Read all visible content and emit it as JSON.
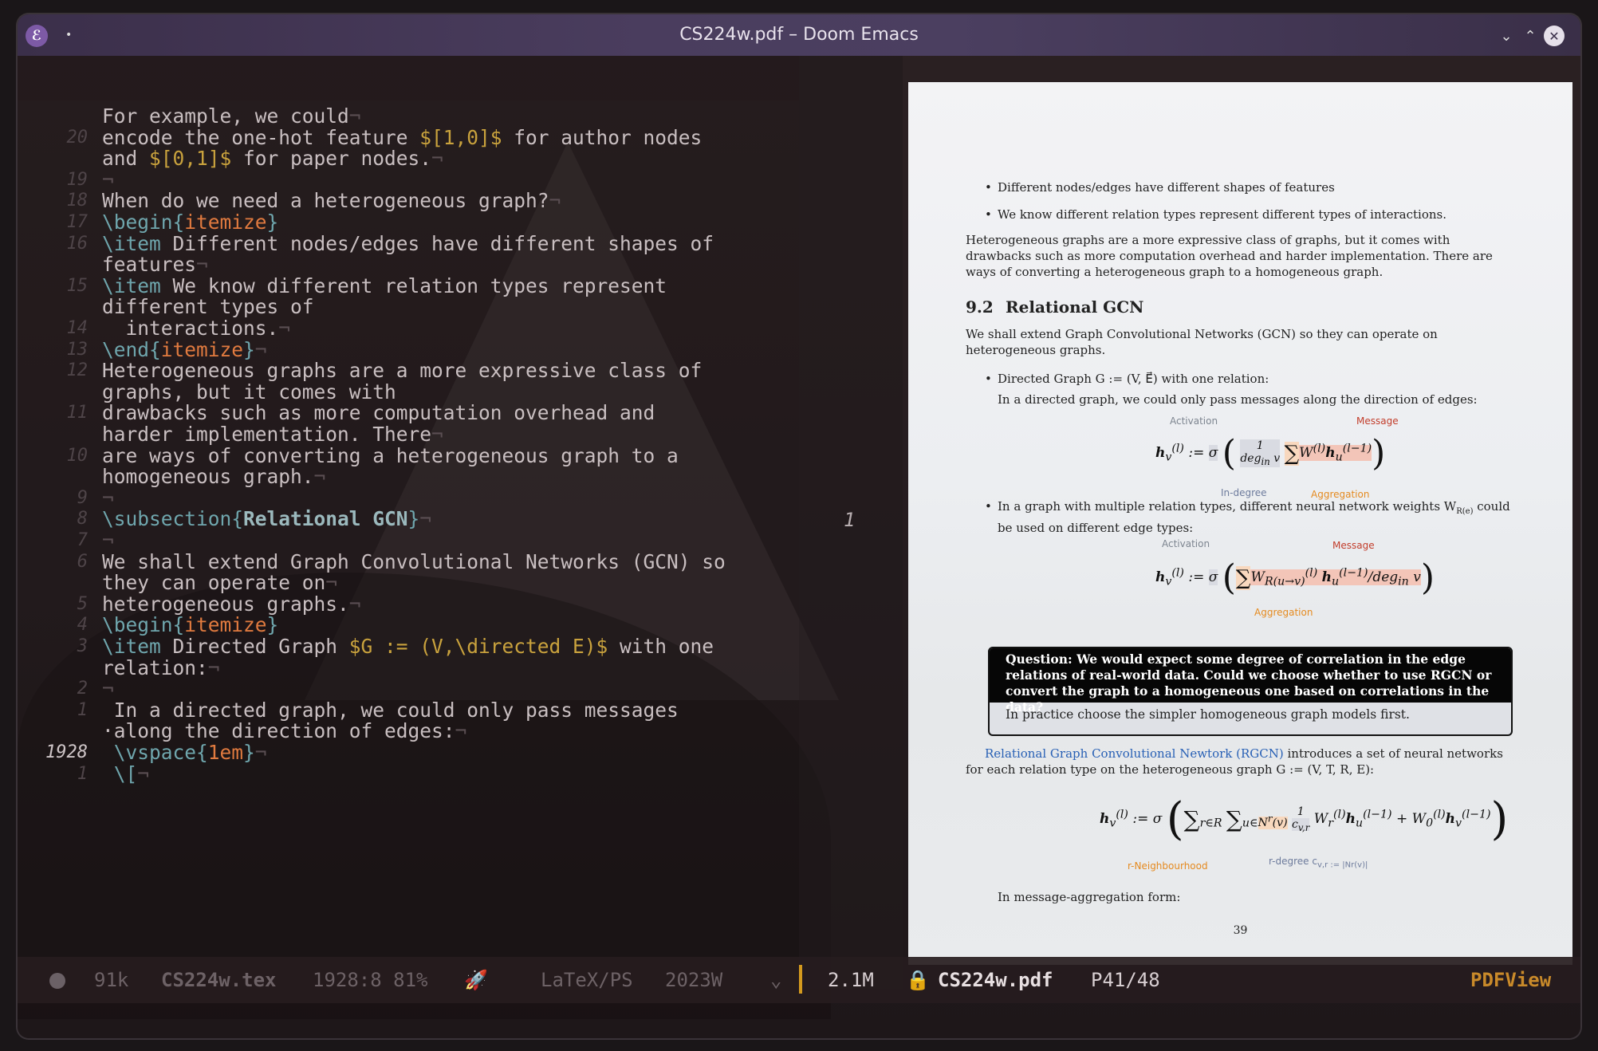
{
  "window": {
    "title": "CS224w.pdf – Doom Emacs",
    "app_icon": "emacs-icon"
  },
  "editor": {
    "lines": [
      {
        "ln": "",
        "segments": [
          {
            "t": "For example, we could",
            "c": ""
          },
          {
            "t": "¬",
            "c": "nl"
          }
        ]
      },
      {
        "ln": "20",
        "segments": [
          {
            "t": "encode the one-hot feature ",
            "c": ""
          },
          {
            "t": "$[1,0]$",
            "c": "math"
          },
          {
            "t": " for author nodes",
            "c": ""
          }
        ]
      },
      {
        "ln": "",
        "segments": [
          {
            "t": "and ",
            "c": ""
          },
          {
            "t": "$[0,1]$",
            "c": "math"
          },
          {
            "t": " for paper nodes.",
            "c": ""
          },
          {
            "t": "¬",
            "c": "nl"
          }
        ]
      },
      {
        "ln": "19",
        "segments": [
          {
            "t": "¬",
            "c": "nl"
          }
        ]
      },
      {
        "ln": "18",
        "segments": [
          {
            "t": "When do we need a heterogeneous graph?",
            "c": ""
          },
          {
            "t": "¬",
            "c": "nl"
          }
        ]
      },
      {
        "ln": "17",
        "segments": [
          {
            "t": "\\begin{",
            "c": "kw"
          },
          {
            "t": "itemize",
            "c": "arg"
          },
          {
            "t": "}",
            "c": "kw"
          }
        ]
      },
      {
        "ln": "16",
        "segments": [
          {
            "t": "\\item",
            "c": "kw"
          },
          {
            "t": " Different nodes/edges have different shapes of",
            "c": ""
          }
        ]
      },
      {
        "ln": "",
        "segments": [
          {
            "t": "features",
            "c": ""
          },
          {
            "t": "¬",
            "c": "nl"
          }
        ]
      },
      {
        "ln": "15",
        "segments": [
          {
            "t": "\\item",
            "c": "kw"
          },
          {
            "t": " We know different relation types represent",
            "c": ""
          }
        ]
      },
      {
        "ln": "",
        "segments": [
          {
            "t": "different types of",
            "c": ""
          }
        ]
      },
      {
        "ln": "14",
        "segments": [
          {
            "t": "  interactions.",
            "c": ""
          },
          {
            "t": "¬",
            "c": "nl"
          }
        ]
      },
      {
        "ln": "13",
        "segments": [
          {
            "t": "\\end{",
            "c": "kw"
          },
          {
            "t": "itemize",
            "c": "arg"
          },
          {
            "t": "}",
            "c": "kw"
          },
          {
            "t": "¬",
            "c": "nl"
          }
        ]
      },
      {
        "ln": "12",
        "segments": [
          {
            "t": "Heterogeneous graphs are a more expressive class of",
            "c": ""
          }
        ]
      },
      {
        "ln": "",
        "segments": [
          {
            "t": "graphs, but it comes with",
            "c": ""
          }
        ]
      },
      {
        "ln": "11",
        "segments": [
          {
            "t": "drawbacks such as more computation overhead and",
            "c": ""
          }
        ]
      },
      {
        "ln": "",
        "segments": [
          {
            "t": "harder implementation. There",
            "c": ""
          },
          {
            "t": "¬",
            "c": "nl"
          }
        ]
      },
      {
        "ln": "10",
        "segments": [
          {
            "t": "are ways of converting a heterogeneous graph to a",
            "c": ""
          }
        ]
      },
      {
        "ln": "",
        "segments": [
          {
            "t": "homogeneous graph.",
            "c": ""
          },
          {
            "t": "¬",
            "c": "nl"
          }
        ]
      },
      {
        "ln": "9",
        "segments": [
          {
            "t": "¬",
            "c": "nl"
          }
        ]
      },
      {
        "ln": "8",
        "segments": [
          {
            "t": "\\subsection{",
            "c": "kw"
          },
          {
            "t": "Relational GCN",
            "c": "bold"
          },
          {
            "t": "}",
            "c": "kw"
          },
          {
            "t": "¬",
            "c": "nl"
          }
        ]
      },
      {
        "ln": "7",
        "segments": [
          {
            "t": "¬",
            "c": "nl"
          }
        ]
      },
      {
        "ln": "6",
        "segments": [
          {
            "t": "We shall extend Graph Convolutional Networks (GCN) so",
            "c": ""
          }
        ]
      },
      {
        "ln": "",
        "segments": [
          {
            "t": "they can operate on",
            "c": ""
          },
          {
            "t": "¬",
            "c": "nl"
          }
        ]
      },
      {
        "ln": "5",
        "segments": [
          {
            "t": "heterogeneous graphs.",
            "c": ""
          },
          {
            "t": "¬",
            "c": "nl"
          }
        ]
      },
      {
        "ln": "4",
        "segments": [
          {
            "t": "\\begin{",
            "c": "kw"
          },
          {
            "t": "itemize",
            "c": "arg"
          },
          {
            "t": "}",
            "c": "kw"
          }
        ]
      },
      {
        "ln": "3",
        "segments": [
          {
            "t": "\\item",
            "c": "kw"
          },
          {
            "t": " Directed Graph ",
            "c": ""
          },
          {
            "t": "$G := (V,\\directed E)$",
            "c": "math"
          },
          {
            "t": " with one",
            "c": ""
          }
        ]
      },
      {
        "ln": "",
        "segments": [
          {
            "t": "relation:",
            "c": ""
          },
          {
            "t": "¬",
            "c": "nl"
          }
        ]
      },
      {
        "ln": "2",
        "segments": [
          {
            "t": "¬",
            "c": "nl"
          }
        ]
      },
      {
        "ln": "1",
        "segments": [
          {
            "t": " In a directed graph, we could only pass messages",
            "c": ""
          }
        ]
      },
      {
        "ln": "",
        "segments": [
          {
            "t": "·along the direction of edges:",
            "c": ""
          },
          {
            "t": "¬",
            "c": "nl"
          }
        ]
      },
      {
        "ln": "1928",
        "segments": [
          {
            "t": " \\vspace{",
            "c": "kw"
          },
          {
            "t": "1em",
            "c": "arg"
          },
          {
            "t": "}",
            "c": "kw"
          },
          {
            "t": "¬",
            "c": "nl"
          }
        ]
      },
      {
        "ln": "1",
        "segments": [
          {
            "t": " \\[",
            "c": "kw"
          },
          {
            "t": "¬",
            "c": "nl"
          }
        ]
      }
    ],
    "current_line_label": "1928",
    "gutter_page_number": "1"
  },
  "pdf": {
    "bullet1": "Different nodes/edges have different shapes of features",
    "bullet2": "We know different relation types represent different types of interactions.",
    "para1": "Heterogeneous graphs are a more expressive class of graphs, but it comes with drawbacks such as more computation overhead and harder implementation. There are ways of converting a heterogeneous graph to a homogeneous graph.",
    "section_num": "9.2",
    "section_title": "Relational GCN",
    "para2": "We shall extend Graph Convolutional Networks (GCN) so they can operate on heterogeneous graphs.",
    "bullet3": "Directed Graph G := (V, E⃗) with one relation:",
    "bullet3_sub": "In a directed graph, we could only pass messages along the direction of edges:",
    "f1_activation": "Activation",
    "f1_message": "Message",
    "f1_indegree": "In-degree",
    "f1_aggregation": "Aggregation",
    "bullet4": "In a graph with multiple relation types, different neural network weights W",
    "bullet4_sub": "R(e)",
    "bullet4_rest": "could be used on different edge types:",
    "f2_activation": "Activation",
    "f2_message": "Message",
    "f2_aggregation": "Aggregation",
    "question": "Question: We would expect some degree of correlation in the edge relations of real-world data. Could we choose whether to use RGCN or convert the graph to a homogeneous one based on correlations in the data?",
    "answer": "In practice choose the simpler homogeneous graph models first.",
    "rgcn_link": "Relational Graph Convolutional Newtork (RGCN)",
    "rgcn_text": " introduces a set of neural networks for each relation type on the heterogeneous graph G := (V, T, R, E):",
    "f3_neigh": "r-Neighbourhood",
    "f3_degree": "r-degree c",
    "f3_degree_rest": "v,r := |N",
    "f3_degree_end": "r(v)|",
    "msg_agg": "In message-aggregation form:",
    "page_number": "39"
  },
  "statusbar": {
    "size_left": "91k",
    "file_left": "CS224w.tex",
    "position": "1928:8 81%",
    "rocket_icon": "rocket-icon",
    "mode": "LaTeX/PS",
    "word_count": "2023W",
    "chevron": "⌄",
    "size_right": "2.1M",
    "lock_icon": "lock-icon",
    "file_right": "CS224w.pdf",
    "page": "P41/48",
    "major_mode": "PDFView"
  },
  "colors": {
    "accent": "#d49a1e",
    "keyword": "#6fa6ad",
    "argument": "#e07a3f",
    "math": "#c9a23d"
  }
}
